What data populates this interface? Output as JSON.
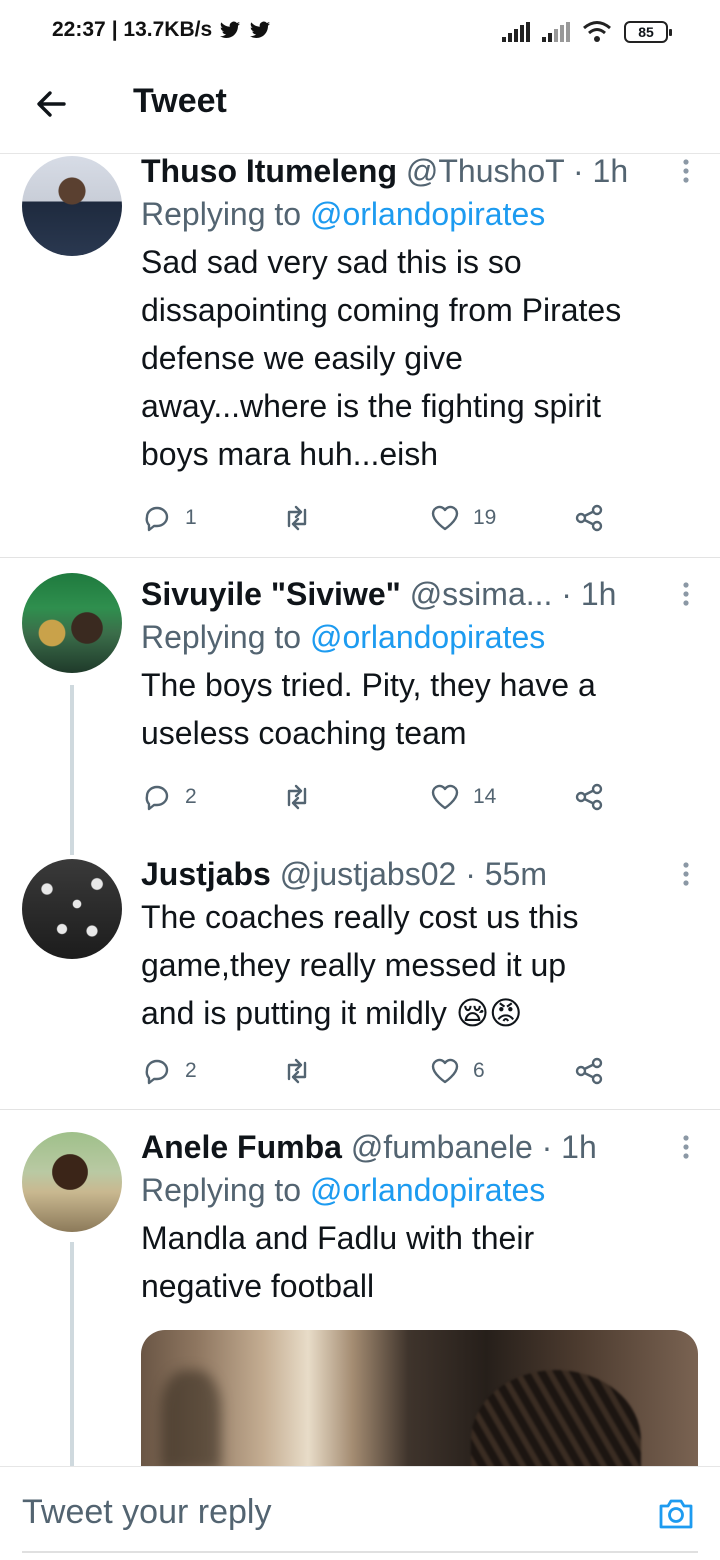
{
  "status_bar": {
    "time": "22:37",
    "speed": "| 13.7KB/s",
    "battery": "85"
  },
  "header": {
    "title": "Tweet"
  },
  "tweets": [
    {
      "name": "Thuso Itumeleng",
      "handle": "@ThushoT",
      "time": "· 1h",
      "replying_prefix": "Replying to ",
      "replying_to": "@orlandopirates",
      "text": "Sad sad very sad this is so\ndissapointing coming from Pirates\ndefense we easily give\naway...where is the fighting spirit\nboys mara huh...eish",
      "replies": "1",
      "likes": "19"
    },
    {
      "name": "Sivuyile \"Siviwe\"",
      "handle": "@ssima...",
      "time": "· 1h",
      "replying_prefix": "Replying to ",
      "replying_to": "@orlandopirates",
      "text": "The boys tried. Pity, they have a\nuseless coaching team",
      "replies": "2",
      "likes": "14"
    },
    {
      "name": "Justjabs",
      "handle": "@justjabs02",
      "time": "· 55m",
      "text": "The  coaches  really  cost us this\ngame,they  really  messed  it up\nand is putting  it mildly ",
      "emoji": "😪😡",
      "replies": "2",
      "likes": "6"
    },
    {
      "name": "Anele Fumba",
      "handle": "@fumbanele",
      "time": "· 1h",
      "replying_prefix": "Replying to ",
      "replying_to": "@orlandopirates",
      "text": "Mandla and Fadlu with their\nnegative football"
    }
  ],
  "reply_bar": {
    "placeholder": "Tweet your reply"
  },
  "colors": {
    "accent": "#1d9bf0",
    "secondary_text": "#536471",
    "divider": "#e3e3e3"
  }
}
